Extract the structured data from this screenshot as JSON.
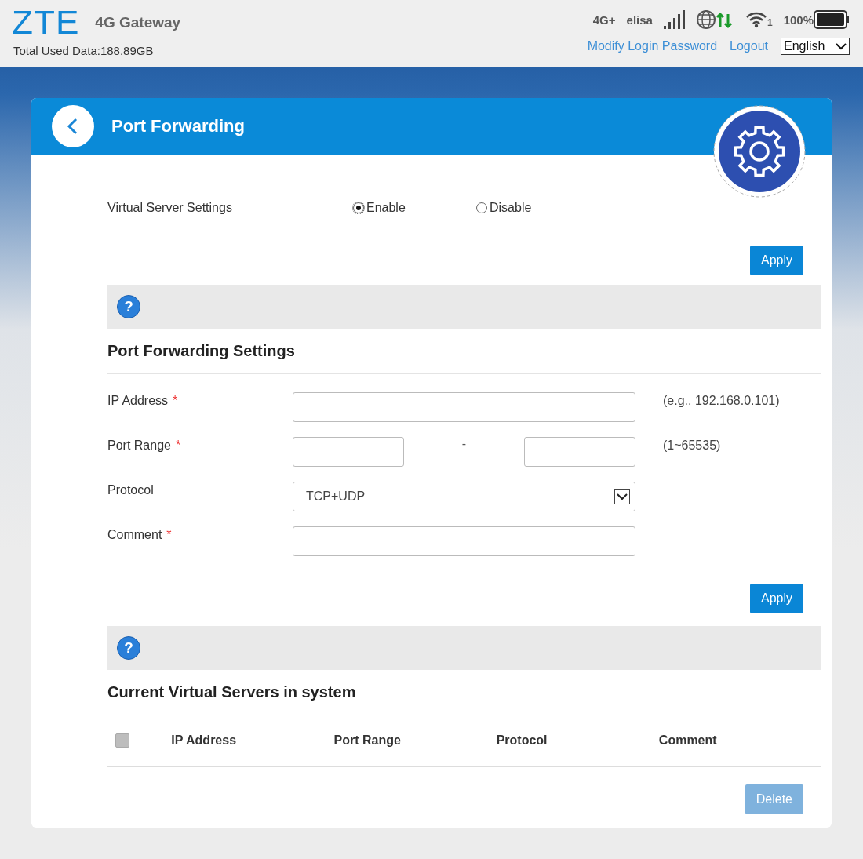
{
  "header": {
    "logo": "ZTE",
    "product": "4G Gateway",
    "total_used": "Total Used Data:188.89GB",
    "network_type": "4G+",
    "operator": "elisa",
    "wifi_clients": "1",
    "battery": "100%",
    "links": [
      "Modify Login Password",
      "Logout"
    ],
    "language": "English"
  },
  "page": {
    "title": "Port Forwarding"
  },
  "virtual_server": {
    "label": "Virtual Server Settings",
    "options": [
      {
        "label": "Enable",
        "selected": true
      },
      {
        "label": "Disable",
        "selected": false
      }
    ],
    "apply": "Apply",
    "help": "?"
  },
  "form": {
    "title": "Port Forwarding Settings",
    "fields": [
      {
        "kind": "text",
        "label": "IP Address",
        "required_mark": "*",
        "hint": "(e.g., 192.168.0.101)"
      },
      {
        "kind": "range",
        "label": "Port Range",
        "required_mark": "*",
        "separator": "-",
        "hint": "(1~65535)"
      },
      {
        "kind": "select",
        "label": "Protocol",
        "value": "TCP+UDP"
      },
      {
        "kind": "text",
        "label": "Comment",
        "required_mark": "*"
      }
    ],
    "apply": "Apply",
    "help": "?"
  },
  "servers": {
    "title": "Current Virtual Servers in system",
    "select_all": {
      "checked": false,
      "disabled": true
    },
    "columns": [
      "IP Address",
      "Port Range",
      "Protocol",
      "Comment"
    ],
    "delete": {
      "label": "Delete",
      "disabled": true
    }
  }
}
